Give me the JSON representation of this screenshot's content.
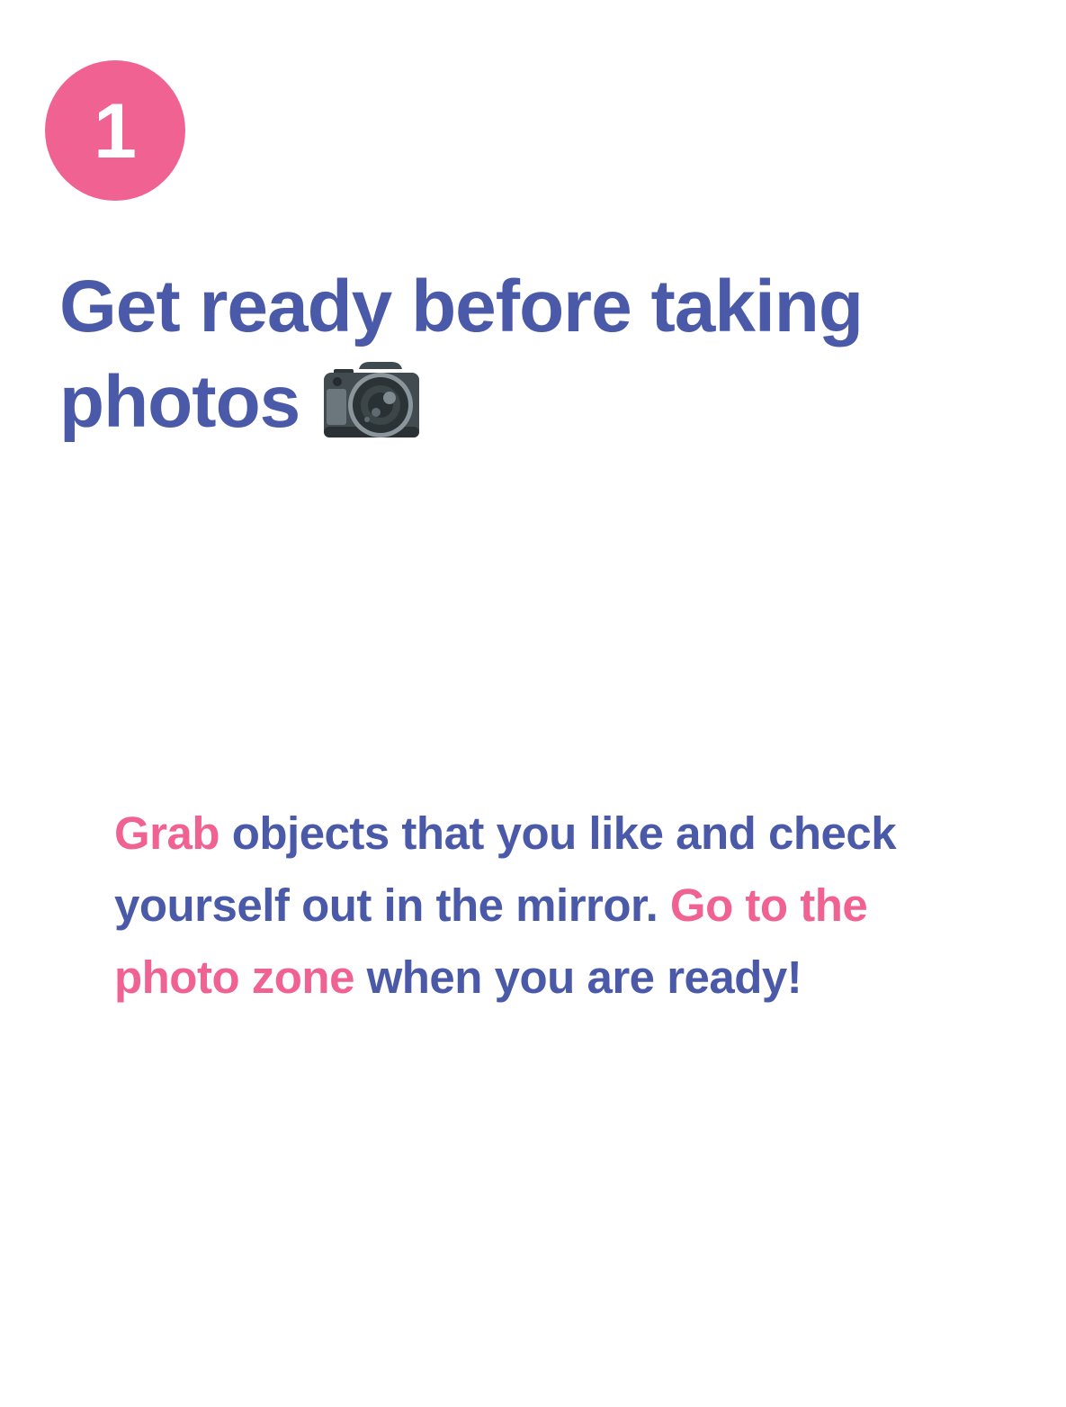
{
  "step": {
    "number": "1"
  },
  "title": {
    "text": "Get ready before taking photos",
    "icon": "camera-icon"
  },
  "body": {
    "segments": [
      {
        "text": "Grab",
        "highlight": true
      },
      {
        "text": " objects that you like and check yourself out in the mirror. ",
        "highlight": false
      },
      {
        "text": "Go to the photo zone",
        "highlight": true
      },
      {
        "text": " when you are ready!",
        "highlight": false
      }
    ]
  },
  "colors": {
    "accent_pink": "#F06292",
    "text_blue": "#4B5AA8",
    "background": "#FFFFFF"
  }
}
